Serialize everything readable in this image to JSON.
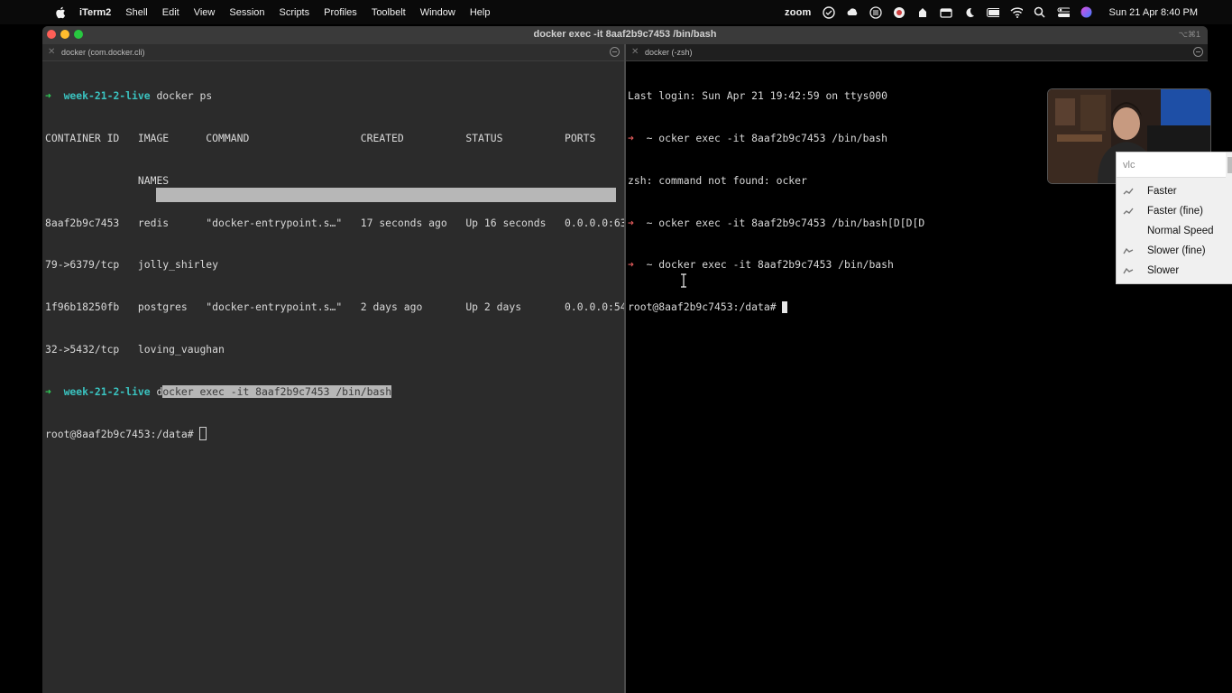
{
  "menubar": {
    "app": "iTerm2",
    "menus": [
      "Shell",
      "Edit",
      "View",
      "Session",
      "Scripts",
      "Profiles",
      "Toolbelt",
      "Window",
      "Help"
    ],
    "zoom_label": "zoom",
    "clock": "Sun 21 Apr  8:40 PM",
    "status_icons": [
      "status-icon-1",
      "status-icon-2",
      "status-icon-3",
      "status-icon-4",
      "status-icon-5",
      "status-icon-6",
      "moon-icon",
      "battery-icon",
      "wifi-icon",
      "search-icon",
      "control-center-icon",
      "siri-icon"
    ]
  },
  "window": {
    "title": "docker exec -it 8aaf2b9c7453 /bin/bash",
    "shortcut": "⌥⌘1"
  },
  "left_pane": {
    "tab_title": "docker (com.docker.cli)",
    "prompt_arrow": "➜",
    "prompt_dir": "week-21-2-live",
    "cmd1": "docker ps",
    "header1": "CONTAINER ID   IMAGE      COMMAND                  CREATED          STATUS          PORTS",
    "header2": "               NAMES",
    "row1a": "8aaf2b9c7453   redis      \"docker-entrypoint.s…\"   17 seconds ago   Up 16 seconds   0.0.0.0:63",
    "row1b": "79->6379/tcp   jolly_shirley",
    "row2a": "1f96b18250fb   postgres   \"docker-entrypoint.s…\"   2 days ago       Up 2 days       0.0.0.0:54",
    "row2b": "32->5432/tcp   loving_vaughan",
    "cmd2_first": "d",
    "cmd2_rest": "ocker exec -it 8aaf2b9c7453 /bin/bash",
    "root_prompt": "root@8aaf2b9c7453:/data# "
  },
  "right_pane": {
    "tab_title": "docker (-zsh)",
    "lines": [
      {
        "text": "Last login: Sun Apr 21 19:42:59 on ttys000"
      },
      {
        "arrow": "➜",
        "text": "  ~ ocker exec -it 8aaf2b9c7453 /bin/bash"
      },
      {
        "text": "zsh: command not found: ocker"
      },
      {
        "arrow": "➜",
        "text": "  ~ ocker exec -it 8aaf2b9c7453 /bin/bash[D[D[D"
      },
      {
        "arrow": "➜",
        "text": "  ~ docker exec -it 8aaf2b9c7453 /bin/bash"
      }
    ],
    "root_prompt": "root@8aaf2b9c7453:/data# "
  },
  "vlc_menu": {
    "search_value": "vlc",
    "items": [
      {
        "label": "Faster",
        "icon": "faster-icon"
      },
      {
        "label": "Faster (fine)",
        "icon": "faster-fine-icon"
      },
      {
        "label": "Normal Speed",
        "icon": ""
      },
      {
        "label": "Slower (fine)",
        "icon": "slower-fine-icon"
      },
      {
        "label": "Slower",
        "icon": "slower-icon"
      }
    ]
  }
}
